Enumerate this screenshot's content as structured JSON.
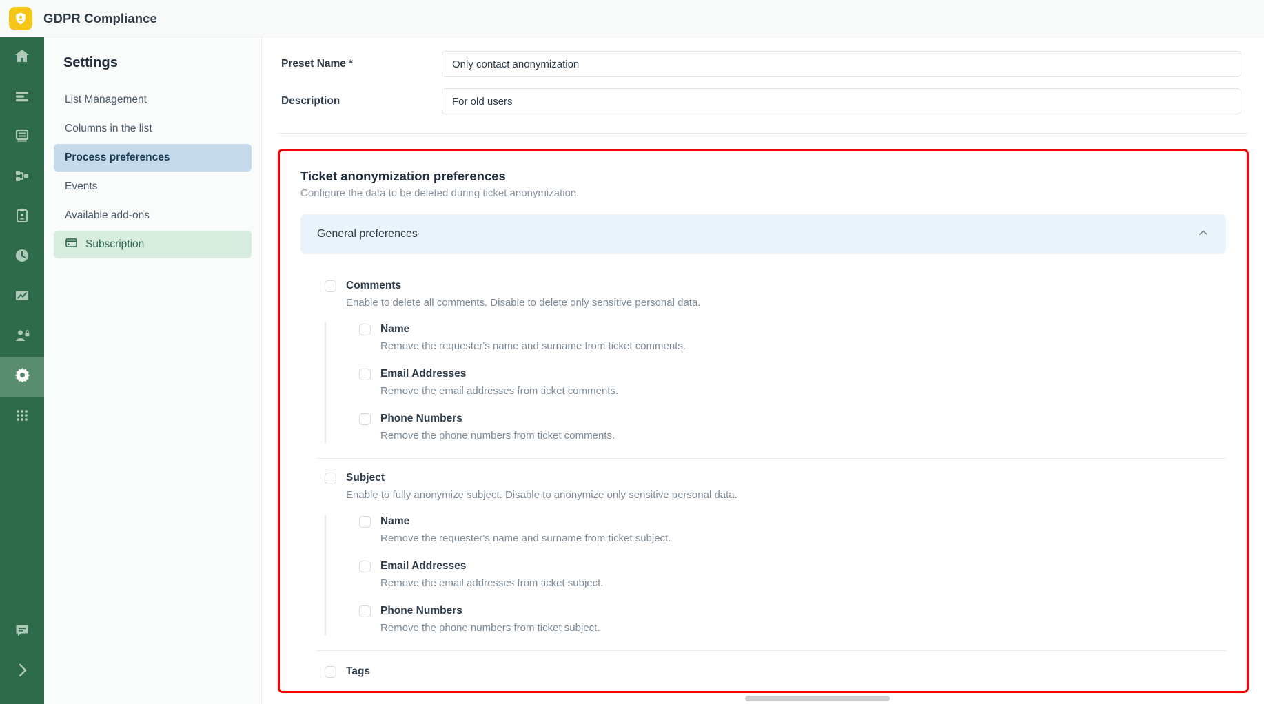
{
  "app": {
    "title": "GDPR Compliance",
    "logo_icon": "shield-user-icon",
    "accent_logo": "#f5c518",
    "rail_color": "#2d6b4a"
  },
  "rail": {
    "items": [
      {
        "icon": "home-icon",
        "active": false
      },
      {
        "icon": "list-icon",
        "active": false
      },
      {
        "icon": "database-icon",
        "active": false
      },
      {
        "icon": "workflow-icon",
        "active": false
      },
      {
        "icon": "clipboard-user-icon",
        "active": false
      },
      {
        "icon": "clock-icon",
        "active": false
      },
      {
        "icon": "chart-image-icon",
        "active": false
      },
      {
        "icon": "user-lock-icon",
        "active": false
      },
      {
        "icon": "gear-icon",
        "active": true
      },
      {
        "icon": "apps-grid-icon",
        "active": false
      }
    ],
    "bottom_items": [
      {
        "icon": "chat-icon"
      },
      {
        "icon": "chevron-right-icon"
      }
    ]
  },
  "settings": {
    "heading": "Settings",
    "items": [
      {
        "label": "List Management",
        "active": false,
        "icon": null
      },
      {
        "label": "Columns in the list",
        "active": false,
        "icon": null
      },
      {
        "label": "Process preferences",
        "active": true,
        "icon": null
      },
      {
        "label": "Events",
        "active": false,
        "icon": null
      },
      {
        "label": "Available add-ons",
        "active": false,
        "icon": null
      },
      {
        "label": "Subscription",
        "active": false,
        "icon": "credit-card-icon"
      }
    ]
  },
  "form": {
    "preset_name_label": "Preset Name *",
    "preset_name_value": "Only contact anonymization",
    "preset_name_placeholder": "Preset Name",
    "description_label": "Description",
    "description_value": "For old users",
    "description_placeholder": "Description"
  },
  "panel": {
    "highlight_color": "#ff0000",
    "title": "Ticket anonymization preferences",
    "subtitle": "Configure the data to be deleted during ticket anonymization.",
    "accordion": {
      "label": "General preferences",
      "expanded": true,
      "chevron_icon": "chevron-up-icon"
    },
    "groups": [
      {
        "label": "Comments",
        "desc": "Enable to delete all comments. Disable to delete only sensitive personal data.",
        "checked": false,
        "children": [
          {
            "label": "Name",
            "desc": "Remove the requester's name and surname from ticket comments.",
            "checked": false
          },
          {
            "label": "Email Addresses",
            "desc": "Remove the email addresses from ticket comments.",
            "checked": false
          },
          {
            "label": "Phone Numbers",
            "desc": "Remove the phone numbers from ticket comments.",
            "checked": false
          }
        ]
      },
      {
        "label": "Subject",
        "desc": "Enable to fully anonymize subject. Disable to anonymize only sensitive personal data.",
        "checked": false,
        "children": [
          {
            "label": "Name",
            "desc": "Remove the requester's name and surname from ticket subject.",
            "checked": false
          },
          {
            "label": "Email Addresses",
            "desc": "Remove the email addresses from ticket subject.",
            "checked": false
          },
          {
            "label": "Phone Numbers",
            "desc": "Remove the phone numbers from ticket subject.",
            "checked": false
          }
        ]
      }
    ],
    "tags": {
      "label": "Tags",
      "checked": false
    }
  }
}
